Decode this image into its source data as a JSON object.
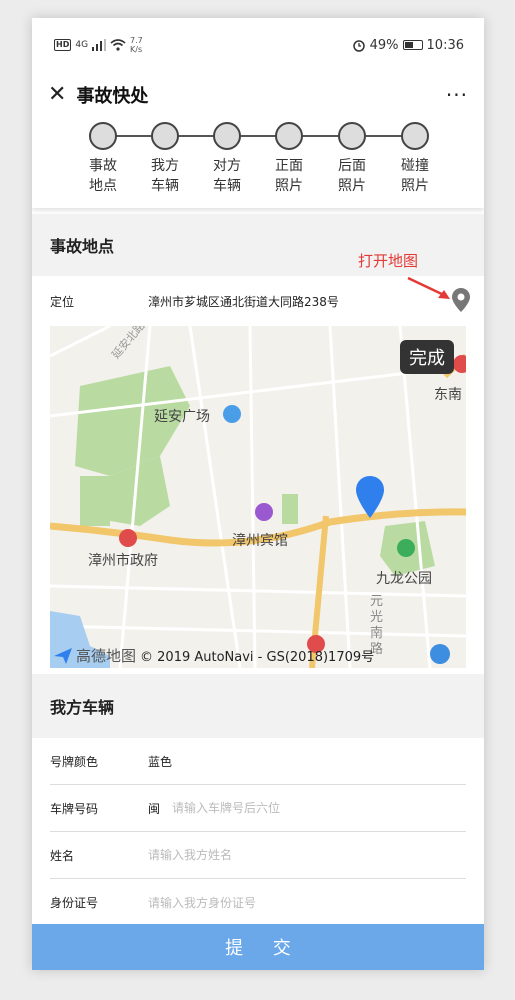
{
  "statusbar": {
    "hd": "HD",
    "network": "4G",
    "speed_value": "7.7",
    "speed_unit": "K/s",
    "battery": "49%",
    "time": "10:36"
  },
  "navbar": {
    "close_icon": "close-icon",
    "title": "事故快处",
    "more": "···"
  },
  "steps": [
    {
      "label": "事故地点"
    },
    {
      "label": "我方车辆"
    },
    {
      "label": "对方车辆"
    },
    {
      "label": "正面照片"
    },
    {
      "label": "后面照片"
    },
    {
      "label": "碰撞照片"
    }
  ],
  "accident_location": {
    "header": "事故地点",
    "annotation": "打开地图",
    "locate_label": "定位",
    "address": "漳州市芗城区通北街道大同路238号"
  },
  "map": {
    "done_label": "完成",
    "labels": {
      "yanan": "延安广场",
      "binguan": "漳州宾馆",
      "zhengfu": "漳州市政府",
      "jiulong": "九龙公园",
      "dongnan": "东南",
      "yuanguang": "元光南路",
      "road_upper": "延安北路"
    },
    "logo": "高德地图",
    "copyright": "© 2019 AutoNavi - GS(2018)1709号"
  },
  "vehicle": {
    "header": "我方车辆",
    "plate_color_label": "号牌颜色",
    "plate_color_value": "蓝色",
    "plate_number_label": "车牌号码",
    "plate_prefix": "闽",
    "plate_placeholder": "请输入车牌号后六位",
    "name_label": "姓名",
    "name_placeholder": "请输入我方姓名",
    "id_label": "身份证号",
    "id_placeholder": "请输入我方身份证号"
  },
  "submit_label": "提 交",
  "colors": {
    "submit": "#6aa8ea",
    "annotation": "#e53935",
    "map_pin": "#2f80ed"
  }
}
